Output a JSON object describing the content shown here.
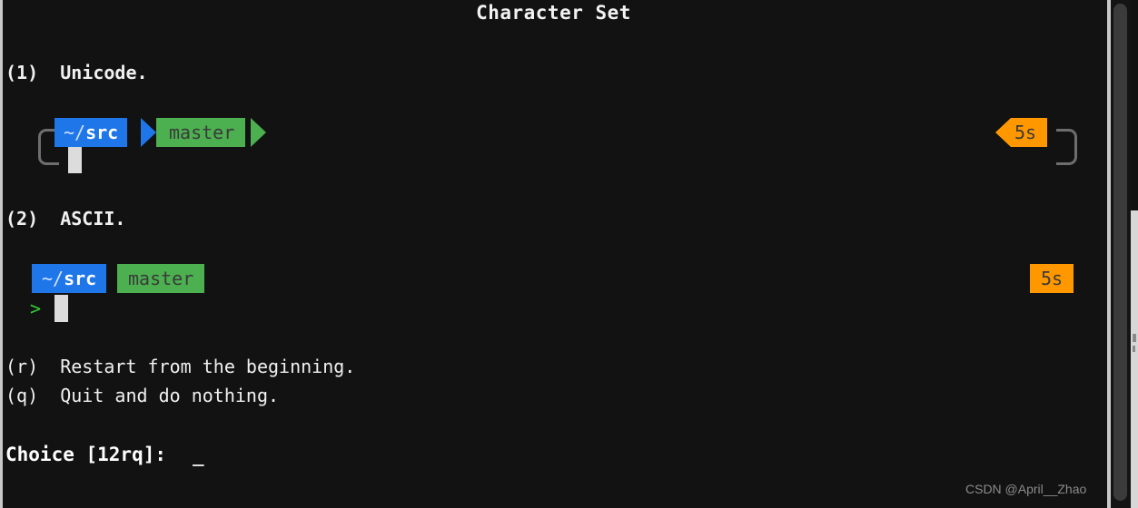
{
  "terminal": {
    "title": "Character Set",
    "background_color": "#121212",
    "options": [
      {
        "key": "(1)",
        "label": "Unicode."
      },
      {
        "key": "(2)",
        "label": "ASCII."
      },
      {
        "key": "(r)",
        "label": "Restart from the beginning."
      },
      {
        "key": "(q)",
        "label": "Quit and do nothing."
      }
    ],
    "option_lines": {
      "unicode": "(1)  Unicode.",
      "ascii": "(2)  ASCII.",
      "restart": "(r)  Restart from the beginning.",
      "quit": "(q)  Quit and do nothing."
    },
    "prompt_preview_unicode": {
      "path": "~/src",
      "path_prefix": "~/",
      "path_name": "src",
      "branch": "master",
      "timer": "5s",
      "path_bg": "#1e76e8",
      "branch_bg": "#4caf50",
      "timer_bg": "#ff9800",
      "bracket_left": "[",
      "bracket_right": "]",
      "cursor": "block"
    },
    "prompt_preview_ascii": {
      "path": "~/src",
      "path_prefix": "~/",
      "path_name": "src",
      "branch": "master",
      "timer": "5s",
      "caret": ">",
      "path_bg": "#1e76e8",
      "branch_bg": "#4caf50",
      "timer_bg": "#ff9800",
      "cursor": "block"
    },
    "choice": {
      "prompt": "Choice [12rq]:",
      "value": "",
      "cursor": "_"
    },
    "watermark": "CSDN @April__Zhao"
  }
}
